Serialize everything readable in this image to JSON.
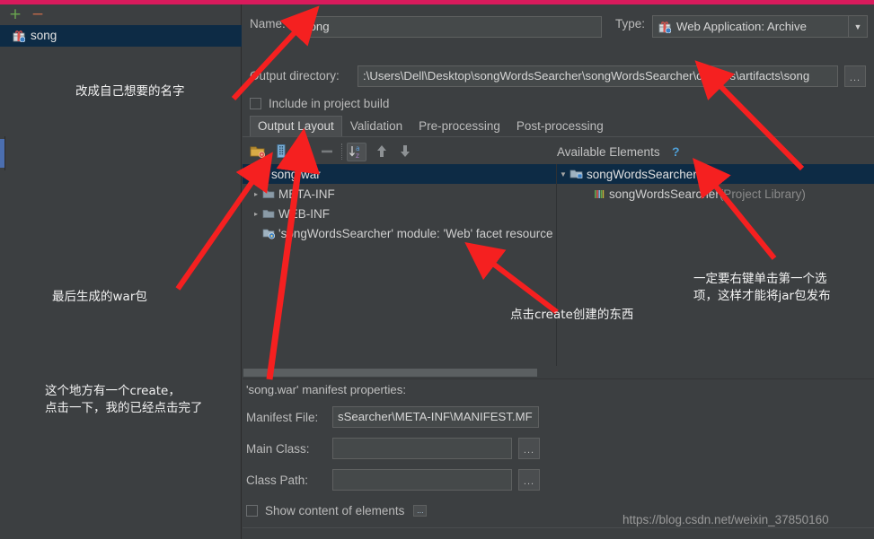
{
  "window": {
    "accent_color": "#d91a5c",
    "background": "#3c3f41"
  },
  "left_panel": {
    "toolbar": {
      "add_label": "+",
      "remove_label": "−"
    },
    "items": [
      {
        "label": "song",
        "icon": "artifact-icon",
        "selected": true
      }
    ]
  },
  "form": {
    "name_label": "Name:",
    "name_value": "song",
    "type_label": "Type:",
    "type_value": "Web Application: Archive",
    "type_icon": "artifact-icon",
    "output_dir_label": "Output directory:",
    "output_dir_value": ":\\Users\\Dell\\Desktop\\songWordsSearcher\\songWordsSearcher\\classes\\artifacts\\song",
    "output_dir_browse": "...",
    "include_in_build_label": "Include in project build",
    "include_in_build_checked": false
  },
  "tabs": [
    {
      "label": "Output Layout",
      "active": true
    },
    {
      "label": "Validation",
      "active": false
    },
    {
      "label": "Pre-processing",
      "active": false
    },
    {
      "label": "Post-processing",
      "active": false
    }
  ],
  "output_layout": {
    "toolbar_icons": [
      "create-directory-icon",
      "create-archive-icon",
      "add-copy-of-icon",
      "remove-icon",
      "sort-icon",
      "move-up-icon",
      "move-down-icon"
    ],
    "available_elements_label": "Available Elements",
    "help_label": "?",
    "left_tree": [
      {
        "label": "song.war",
        "icon": "war-icon",
        "depth": 0,
        "selected": true,
        "twisty": ""
      },
      {
        "label": "META-INF",
        "icon": "folder-icon",
        "depth": 1,
        "selected": false,
        "twisty": "▸"
      },
      {
        "label": "WEB-INF",
        "icon": "folder-icon",
        "depth": 1,
        "selected": false,
        "twisty": "▸"
      },
      {
        "label": "'songWordsSearcher' module: 'Web' facet resource",
        "icon": "module-icon",
        "depth": 1,
        "selected": false,
        "twisty": ""
      }
    ],
    "right_tree": [
      {
        "label": "songWordsSearcher",
        "icon": "module-folder-icon",
        "depth": 0,
        "selected": true,
        "twisty": "▼"
      },
      {
        "label": "songWordsSearcher",
        "suffix": " (Project Library)",
        "icon": "library-icon",
        "depth": 1,
        "selected": false,
        "twisty": ""
      }
    ]
  },
  "manifest": {
    "title": "'song.war' manifest properties:",
    "manifest_file_label": "Manifest File:",
    "manifest_file_value": "sSearcher\\META-INF\\MANIFEST.MF",
    "main_class_label": "Main Class:",
    "main_class_value": "",
    "main_class_browse": "...",
    "class_path_label": "Class Path:",
    "class_path_value": "",
    "class_path_browse": "...",
    "show_content_label": "Show content of elements",
    "show_content_checked": false,
    "show_content_browse": "..."
  },
  "watermark": "https://blog.csdn.net/weixin_37850160",
  "annotations": [
    {
      "id": "anno-name",
      "text": "改成自己想要的名字"
    },
    {
      "id": "anno-war",
      "text": "最后生成的war包"
    },
    {
      "id": "anno-create-here",
      "text": "这个地方有一个create，\n点击一下，我的已经点击完了"
    },
    {
      "id": "anno-create-thing",
      "text": "点击create创建的东西"
    },
    {
      "id": "anno-rightclick",
      "text": "一定要右键单击第一个选\n项，这样才能将jar包发布"
    }
  ]
}
